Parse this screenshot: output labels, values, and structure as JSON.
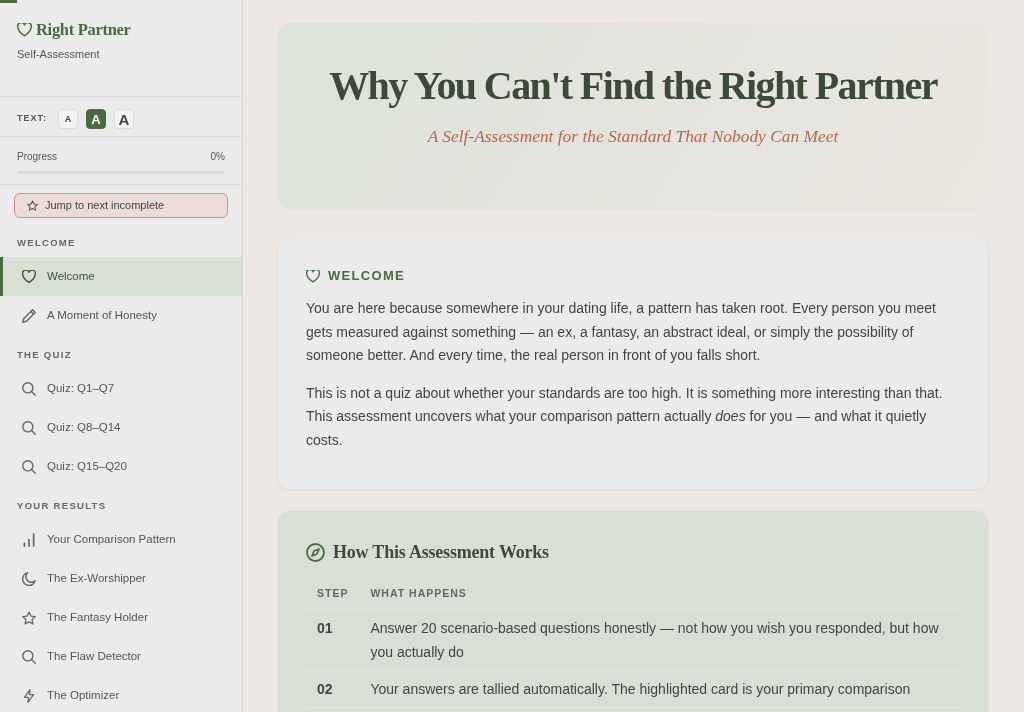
{
  "reading_progress": {
    "level": 0.017
  },
  "sidebar": {
    "brand": "Right Partner",
    "tagline": "Self-Assessment",
    "text_size": {
      "label": "TEXT:",
      "options": [
        {
          "label": "A",
          "kind": "small",
          "selected": false
        },
        {
          "label": "A",
          "kind": "medium",
          "selected": true
        },
        {
          "label": "A",
          "kind": "large",
          "selected": false
        }
      ]
    },
    "progress": {
      "label": "Progress",
      "reading": "0%",
      "level": 0
    },
    "jump_button": "Jump to next incomplete",
    "sections": [
      {
        "title": "WELCOME",
        "items": [
          {
            "label": "Welcome",
            "kind": "heart",
            "selected": true
          },
          {
            "label": "A Moment of Honesty",
            "kind": "pencil",
            "selected": false
          }
        ]
      },
      {
        "title": "THE QUIZ",
        "items": [
          {
            "label": "Quiz: Q1–Q7",
            "kind": "search",
            "selected": false
          },
          {
            "label": "Quiz: Q8–Q14",
            "kind": "search",
            "selected": false
          },
          {
            "label": "Quiz: Q15–Q20",
            "kind": "search",
            "selected": false
          }
        ]
      },
      {
        "title": "YOUR RESULTS",
        "items": [
          {
            "label": "Your Comparison Pattern",
            "kind": "chart",
            "selected": false
          },
          {
            "label": "The Ex-Worshipper",
            "kind": "moon",
            "selected": false
          },
          {
            "label": "The Fantasy Holder",
            "kind": "star",
            "selected": false
          },
          {
            "label": "The Flaw Detector",
            "kind": "search",
            "selected": false
          },
          {
            "label": "The Optimizer",
            "kind": "bolt",
            "selected": false
          }
        ]
      }
    ]
  },
  "hero": {
    "title": "Why You Can't Find the Right Partner",
    "subtitle": "A Self-Assessment for the Standard That Nobody Can Meet"
  },
  "welcome": {
    "heading": "WELCOME",
    "paragraphs": [
      "You are here because somewhere in your dating life, a pattern has taken root. Every person you meet gets measured against something — an ex, a fantasy, an abstract ideal, or simply the possibility of someone better. And every time, the real person in front of you falls short.",
      "This is not a quiz about whether your standards are too high. It is something more interesting than that. This assessment uncovers what your comparison pattern actually *does* for you — and what it quietly costs."
    ]
  },
  "how_it_works": {
    "heading": "How This Assessment Works",
    "columns": [
      "STEP",
      "WHAT HAPPENS"
    ],
    "rows": [
      {
        "step": "01",
        "text": "Answer 20 scenario-based questions honestly — not how you wish you responded, but how you actually do"
      },
      {
        "step": "02",
        "text": "Your answers are tallied automatically. The highlighted card is your primary comparison"
      }
    ]
  }
}
